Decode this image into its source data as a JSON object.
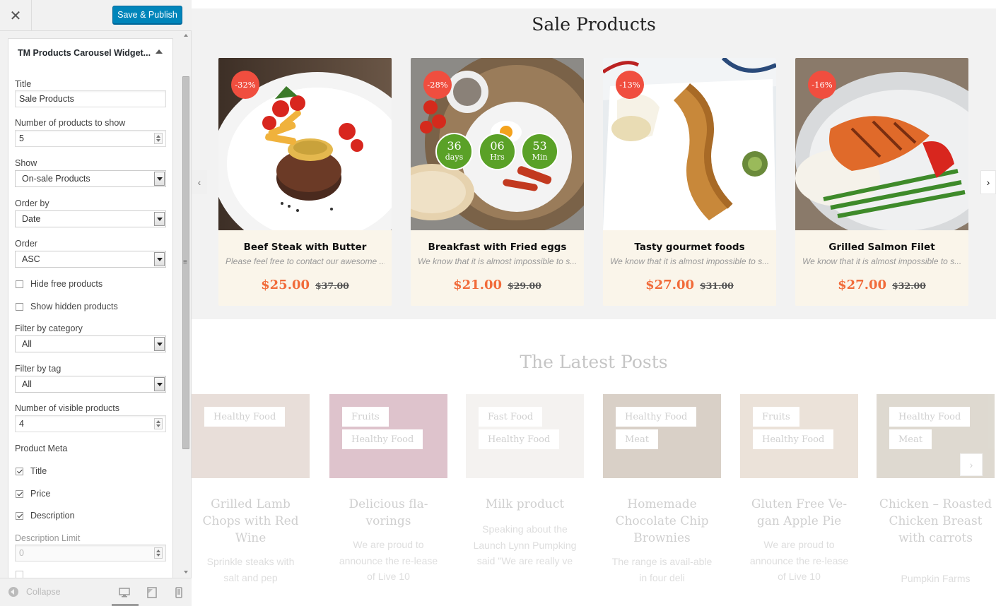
{
  "header": {
    "publish_label": "Save & Publish"
  },
  "widget": {
    "header": "TM Products Carousel Widget...",
    "fields": {
      "title": {
        "label": "Title",
        "value": "Sale Products"
      },
      "number_to_show": {
        "label": "Number of products to show",
        "value": "5"
      },
      "show": {
        "label": "Show",
        "value": "On-sale Products"
      },
      "order_by": {
        "label": "Order by",
        "value": "Date"
      },
      "order": {
        "label": "Order",
        "value": "ASC"
      },
      "hide_free": {
        "label": "Hide free products",
        "checked": false
      },
      "show_hidden": {
        "label": "Show hidden products",
        "checked": false
      },
      "filter_category": {
        "label": "Filter by category",
        "value": "All"
      },
      "filter_tag": {
        "label": "Filter by tag",
        "value": "All"
      },
      "visible_products": {
        "label": "Number of visible products",
        "value": "4"
      },
      "product_meta": {
        "label": "Product Meta",
        "items": [
          "Title",
          "Price",
          "Description"
        ],
        "checked": [
          true,
          true,
          true
        ]
      },
      "description_limit": {
        "label": "Description Limit",
        "value": "0"
      }
    }
  },
  "footer": {
    "collapse_label": "Collapse",
    "devices": [
      "desktop-icon",
      "tablet-icon",
      "mobile-icon"
    ]
  },
  "preview": {
    "sale_title": "Sale Products",
    "posts_title": "The Latest Posts"
  },
  "colors": {
    "accent": "#0085ba",
    "badge": "#f04e3f",
    "price": "#f16b3a",
    "timer": "#5aa127",
    "card_bg": "#faf5ea"
  },
  "products": [
    {
      "name": "Beef Steak with Butter",
      "description": "Please feel free to contact our awesome ...",
      "price": "$25.00",
      "old_price": "$37.00",
      "discount": "-32%"
    },
    {
      "name": "Breakfast with Fried eggs",
      "description": "We know that it is almost impossible to s...",
      "price": "$21.00",
      "old_price": "$29.00",
      "discount": "-28%",
      "countdown": [
        {
          "value": "36",
          "unit": "days"
        },
        {
          "value": "06",
          "unit": "Hrs"
        },
        {
          "value": "53",
          "unit": "Min"
        }
      ]
    },
    {
      "name": "Tasty gourmet foods",
      "description": "We know that it is almost impossible to s...",
      "price": "$27.00",
      "old_price": "$31.00",
      "discount": "-13%"
    },
    {
      "name": "Grilled Salmon Filet",
      "description": "We know that it is almost impossible to s...",
      "price": "$27.00",
      "old_price": "$32.00",
      "discount": "-16%"
    }
  ],
  "posts": [
    {
      "title": "Grilled Lamb Chops with Red Wine",
      "tags": [
        "Healthy Food"
      ],
      "excerpt": "Sprinkle steaks with salt and pep"
    },
    {
      "title": "Delicious fla-vorings",
      "tags": [
        "Fruits",
        "Healthy Food"
      ],
      "excerpt": "We are proud to announce the re-lease of Live 10"
    },
    {
      "title": "Milk product",
      "tags": [
        "Fast Food",
        "Healthy Food"
      ],
      "excerpt": "Speaking about the Launch Lynn Pumpking said \"We are really ve"
    },
    {
      "title": "Homemade Chocolate Chip Brownies",
      "tags": [
        "Healthy Food",
        "Meat"
      ],
      "excerpt": "The range is avail-able in four deli"
    },
    {
      "title": "Gluten Free Ve-gan Apple Pie",
      "tags": [
        "Fruits",
        "Healthy Food"
      ],
      "excerpt": "We are proud to announce the re-lease of Live 10"
    },
    {
      "title": "Chicken – Roasted Chicken Breast with carrots",
      "tags": [
        "Healthy Food",
        "Meat"
      ],
      "excerpt": "Pumpkin Farms"
    }
  ]
}
